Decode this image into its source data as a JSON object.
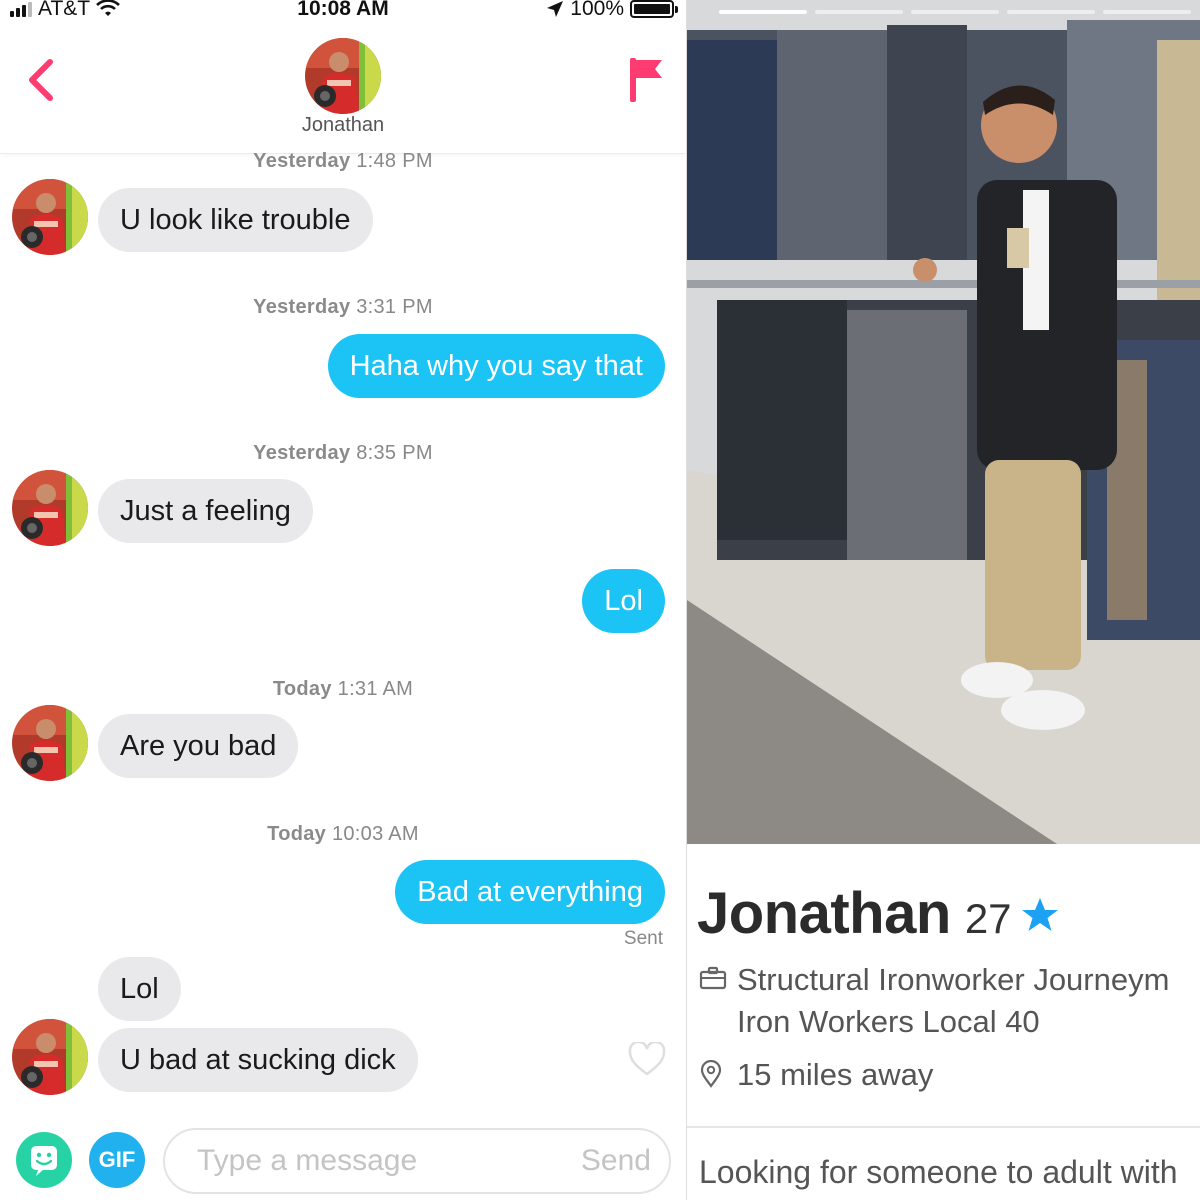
{
  "status_bar": {
    "carrier": "AT&T",
    "time": "10:08 AM",
    "battery": "100%"
  },
  "chat": {
    "header": {
      "name": "Jonathan"
    },
    "timestamps": [
      {
        "day": "Yesterday",
        "time": "1:48 PM"
      },
      {
        "day": "Yesterday",
        "time": "3:31 PM"
      },
      {
        "day": "Yesterday",
        "time": "8:35 PM"
      },
      {
        "day": "Today",
        "time": "1:31 AM"
      },
      {
        "day": "Today",
        "time": "10:03 AM"
      }
    ],
    "messages": [
      {
        "text": "U look like trouble",
        "from": "them"
      },
      {
        "text": "Haha why you say that",
        "from": "me"
      },
      {
        "text": "Just a feeling",
        "from": "them"
      },
      {
        "text": "Lol",
        "from": "me"
      },
      {
        "text": "Are you bad",
        "from": "them"
      },
      {
        "text": "Bad at everything",
        "from": "me"
      },
      {
        "text": "Lol",
        "from": "them"
      },
      {
        "text": "U bad at sucking dick",
        "from": "them"
      }
    ],
    "sent_label": "Sent",
    "composer": {
      "gif_label": "GIF",
      "placeholder": "Type a message",
      "send_label": "Send"
    }
  },
  "profile": {
    "name": "Jonathan",
    "age": "27",
    "job": "Structural Ironworker Journeym",
    "company": "Iron Workers Local 40",
    "distance": "15 miles away",
    "bio": "Looking for someone to adult with"
  },
  "colors": {
    "accent": "#fe3c72",
    "outgoing_bubble": "#1bc4f5",
    "incoming_bubble": "#e9e9eb",
    "gif_button": "#20b1ee",
    "sticker_button": "#27d3a4",
    "verified_star": "#1da1f2"
  },
  "icons": {
    "back": "chevron-left-icon",
    "report": "flag-icon",
    "like": "heart-outline-icon",
    "sticker": "sticker-face-icon",
    "job": "briefcase-icon",
    "location": "location-pin-icon",
    "verified": "star-icon"
  }
}
